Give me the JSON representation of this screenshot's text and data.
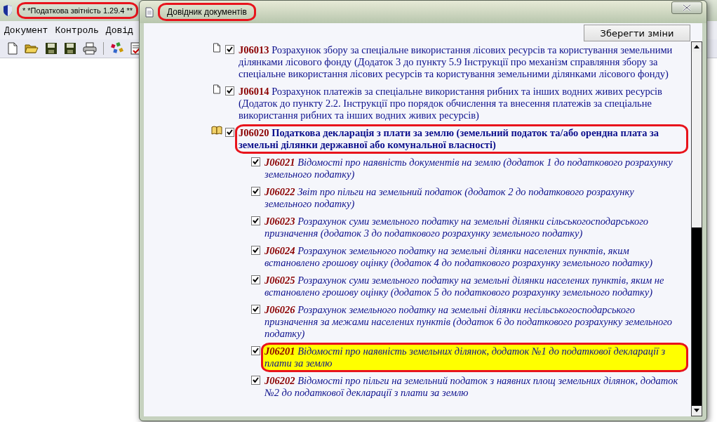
{
  "main_window": {
    "title": "* *Податкова звітність 1.29.4 **",
    "title_circled": true,
    "menu": [
      "Документ",
      "Контроль",
      "Довід"
    ],
    "toolbar": [
      {
        "kind": "new"
      },
      {
        "kind": "open"
      },
      {
        "kind": "save"
      },
      {
        "kind": "save"
      },
      {
        "kind": "print"
      },
      {
        "kind": "separator"
      },
      {
        "kind": "tools"
      },
      {
        "kind": "checklist"
      }
    ]
  },
  "dialog": {
    "title": "Довідник документів",
    "title_circled": true,
    "save_button": "Зберегти зміни",
    "documents": [
      {
        "kind": "document",
        "checked": true,
        "code": "J06013",
        "text": "Розрахунок збору за спеціальне використання лісових ресурсів та користування земельними ділянками лісового фонду (Додаток 3 до пункту 5.9 Інструкції про механізм справляння збору за спеціальне використання лісових ресурсів та користування земельними ділянками лісового фонду)",
        "circled": false,
        "highlighted": false
      },
      {
        "kind": "document",
        "checked": true,
        "code": "J06014",
        "text": "Розрахунок платежів за спеціальне використання рибних та інших водних живих ресурсів (Додаток до пункту 2.2. Інструкції про порядок обчислення та внесення платежів за спеціальне використання рибних та інших водних живих ресурсів)",
        "circled": false,
        "highlighted": false
      },
      {
        "kind": "group",
        "checked": true,
        "code": "J06020",
        "text": "Податкова декларація з плати за землю (земельний податок та/або орендна плата за земельні ділянки державної або комунальної власності)",
        "circled": true,
        "highlighted": false,
        "children": [
          {
            "checked": true,
            "code": "J06021",
            "text": "Відомості про наявність документів на землю (додаток 1 до податкового розрахунку земельного податку)",
            "circled": false,
            "highlighted": false
          },
          {
            "checked": true,
            "code": "J06022",
            "text": "Звіт про пільги на земельний податок (додаток 2 до податкового розрахунку земельного податку)",
            "circled": false,
            "highlighted": false
          },
          {
            "checked": true,
            "code": "J06023",
            "text": "Розрахунок суми земельного податку на земельні ділянки сільськогосподарського призначення (додаток 3 до податкового розрахунку земельного податку)",
            "circled": false,
            "highlighted": false
          },
          {
            "checked": true,
            "code": "J06024",
            "text": "Розрахунок земельного податку на земельні ділянки населених пунктів, яким встановлено грошову оцінку (додаток 4 до податкового розрахунку земельного податку)",
            "circled": false,
            "highlighted": false
          },
          {
            "checked": true,
            "code": "J06025",
            "text": "Розрахунок суми земельного податку на земельні ділянки населених пунктів, яким не встановлено грошову оцінку (додаток 5 до податкового розрахунку земельного податку)",
            "circled": false,
            "highlighted": false
          },
          {
            "checked": true,
            "code": "J06026",
            "text": "Розрахунок земельного податку на земельні ділянки несільськогосподарського призначення за межами населених пунктів (додаток 6 до податкового розрахунку земельного податку)",
            "circled": false,
            "highlighted": false
          },
          {
            "checked": true,
            "code": "J06201",
            "text": "Відомості про наявність земельних ділянок, додаток №1 до податкової декларації з плати за землю",
            "circled": true,
            "highlighted": true
          },
          {
            "checked": true,
            "code": "J06202",
            "text": "Відомості про пільги на земельний податок з наявних площ земельних ділянок, додаток №2 до податкової декларації з плати за землю",
            "circled": false,
            "highlighted": false
          }
        ]
      }
    ]
  }
}
